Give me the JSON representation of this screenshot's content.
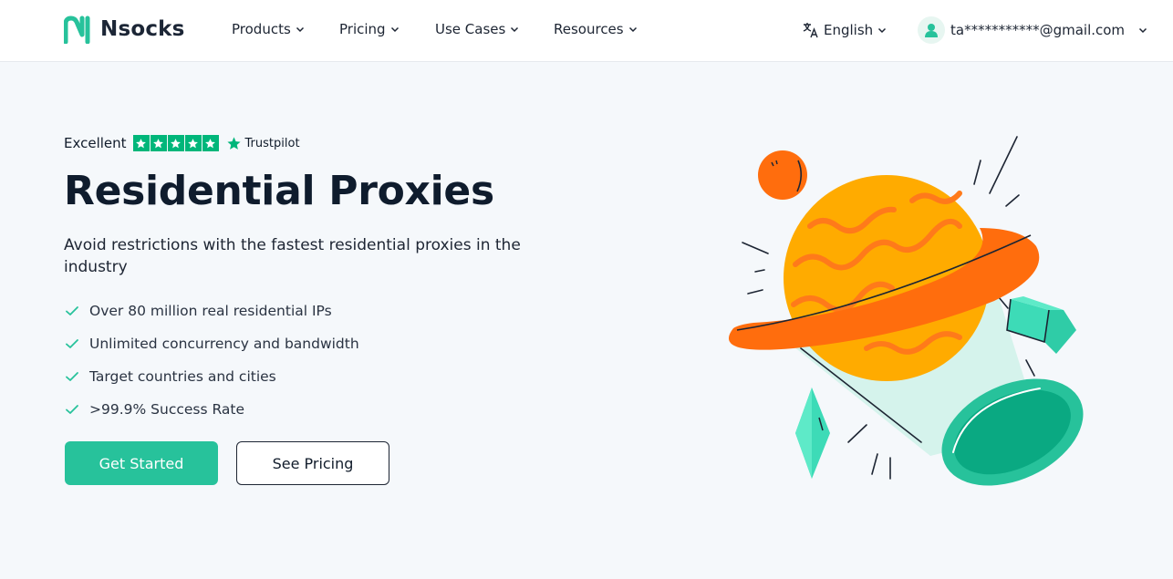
{
  "header": {
    "brand": "Nsocks",
    "nav": [
      {
        "label": "Products"
      },
      {
        "label": "Pricing"
      },
      {
        "label": "Use Cases"
      },
      {
        "label": "Resources"
      }
    ],
    "language": "English",
    "user_email": "ta***********@gmail.com"
  },
  "hero": {
    "rating_label": "Excellent",
    "stars": 5,
    "rating_source": "Trustpilot",
    "title": "Residential Proxies",
    "subtitle": "Avoid restrictions with the fastest residential proxies in the industry",
    "features": [
      "Over 80 million real residential IPs",
      "Unlimited concurrency and bandwidth",
      "Target countries and cities",
      ">99.9% Success Rate"
    ],
    "primary_button": "Get Started",
    "secondary_button": "See Pricing"
  },
  "icons": {
    "logo": "nsocks-logo-icon",
    "language": "translate-icon",
    "avatar": "user-icon",
    "chevron": "chevron-down-icon",
    "check": "check-icon",
    "star": "star-icon"
  },
  "colors": {
    "brand": "#27c29b",
    "trustpilot": "#00b67a",
    "planet": "#ffab00",
    "ring": "#ff6d0d",
    "background": "#f5f8fb"
  }
}
